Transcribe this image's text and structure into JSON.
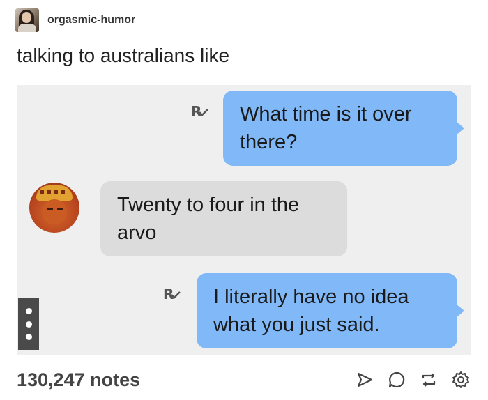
{
  "post": {
    "username": "orgasmic-humor",
    "title": "talking to australians like"
  },
  "chat": {
    "messages": [
      {
        "sender": "me",
        "text": "What time is it over there?",
        "receipt": "R"
      },
      {
        "sender": "contact",
        "text": "Twenty to four in the arvo"
      },
      {
        "sender": "me",
        "text": "I literally have no idea what you just said.",
        "receipt": "R"
      }
    ]
  },
  "footer": {
    "notes": "130,247 notes",
    "actions": [
      "share-icon",
      "reply-icon",
      "reblog-icon",
      "settings-icon"
    ]
  },
  "colors": {
    "sent_bubble": "#80b8f8",
    "received_bubble": "#dcdcdc",
    "chat_background": "#efefef"
  }
}
